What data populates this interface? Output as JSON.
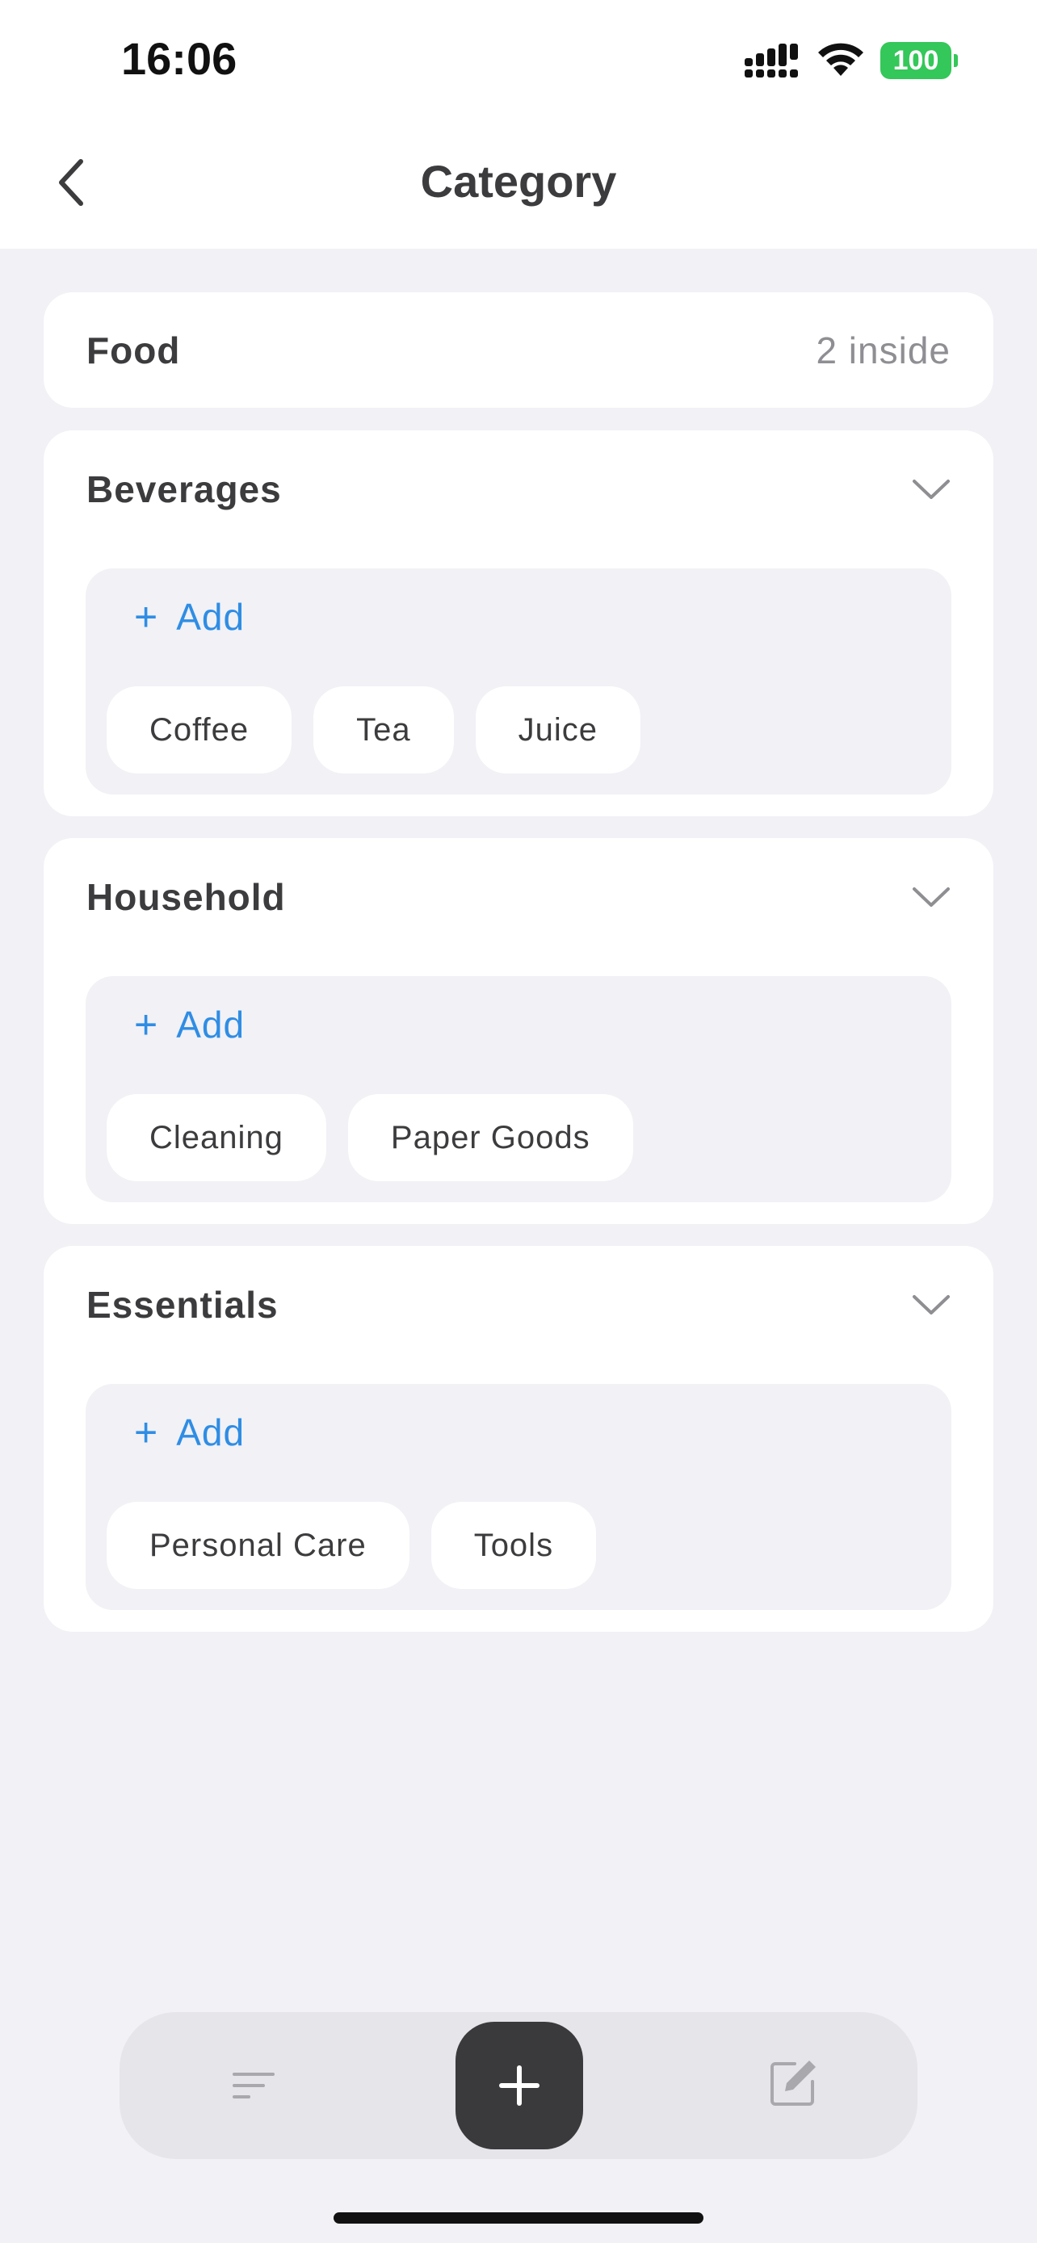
{
  "status_bar": {
    "time": "16:06",
    "battery": "100",
    "icons": [
      "signal-icon",
      "wifi-icon",
      "battery-icon"
    ]
  },
  "nav": {
    "title": "Category",
    "back_icon": "chevron-left-icon"
  },
  "food": {
    "title": "Food",
    "count": "2 inside"
  },
  "groups": [
    {
      "title": "Beverages",
      "add_label": "Add",
      "items": [
        "Coffee",
        "Tea",
        "Juice"
      ]
    },
    {
      "title": "Household",
      "add_label": "Add",
      "items": [
        "Cleaning",
        "Paper Goods"
      ]
    },
    {
      "title": "Essentials",
      "add_label": "Add",
      "items": [
        "Personal Care",
        "Tools"
      ]
    }
  ],
  "toolbar": {
    "left_icon": "list-icon",
    "center_icon": "plus-icon",
    "right_icon": "edit-icon"
  },
  "colors": {
    "background": "#F1F1F6",
    "card": "#FFFFFF",
    "accent": "#2F8DE4",
    "battery": "#34C759",
    "fab": "#3A3A3C"
  }
}
